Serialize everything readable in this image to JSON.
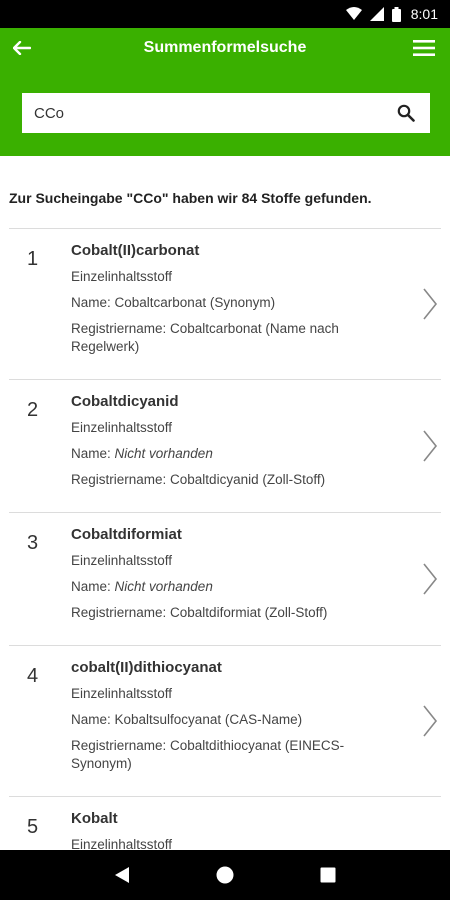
{
  "status_bar": {
    "time": "8:01"
  },
  "app_bar": {
    "title": "Summenformelsuche"
  },
  "search": {
    "value": "CCo"
  },
  "summary": "Zur Sucheingabe \"CCo\" haben wir 84 Stoffe gefunden.",
  "results": [
    {
      "number": "1",
      "title": "Cobalt(II)carbonat",
      "type": "Einzelinhaltsstoff",
      "name_label": "Name: ",
      "name_value": "Cobaltcarbonat (Synonym)",
      "reg_line1": "Registriername: Cobaltcarbonat (Name nach",
      "reg_line2": "Regelwerk)"
    },
    {
      "number": "2",
      "title": "Cobaltdicyanid",
      "type": "Einzelinhaltsstoff",
      "name_label": "Name: ",
      "name_value": "Nicht vorhanden",
      "reg_line1": "Registriername: Cobaltdicyanid (Zoll-Stoff)",
      "reg_line2": ""
    },
    {
      "number": "3",
      "title": "Cobaltdiformiat",
      "type": "Einzelinhaltsstoff",
      "name_label": "Name: ",
      "name_value": "Nicht vorhanden",
      "reg_line1": "Registriername: Cobaltdiformiat (Zoll-Stoff)",
      "reg_line2": ""
    },
    {
      "number": "4",
      "title": "cobalt(II)dithiocyanat",
      "type": "Einzelinhaltsstoff",
      "name_label": "Name: ",
      "name_value": "Kobaltsulfocyanat (CAS-Name)",
      "reg_line1": "Registriername: Cobaltdithiocyanat (EINECS-",
      "reg_line2": "Synonym)"
    },
    {
      "number": "5",
      "title": "Kobalt",
      "type": "Einzelinhaltsstoff",
      "name_label": "",
      "name_value": "",
      "reg_line1": "",
      "reg_line2": ""
    }
  ],
  "colors": {
    "accent": "#3ab000"
  },
  "icons": {
    "back": "arrow-left-icon",
    "menu": "hamburger-menu-icon",
    "search": "search-icon",
    "chevron": "chevron-right-icon"
  }
}
